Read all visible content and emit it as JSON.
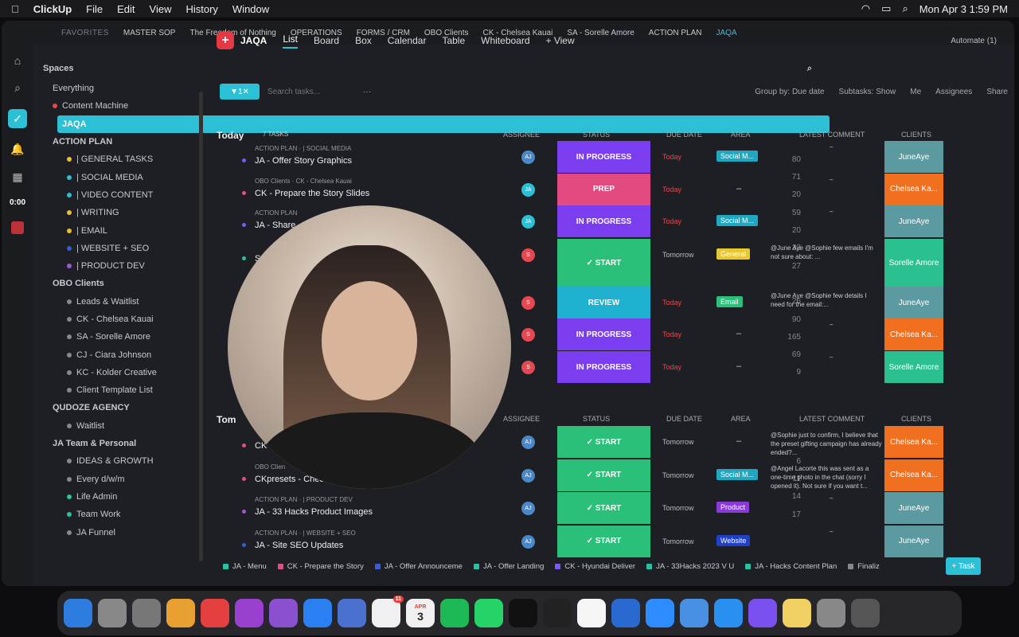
{
  "menubar": {
    "app": "ClickUp",
    "items": [
      "File",
      "Edit",
      "View",
      "History",
      "Window"
    ],
    "clock": "Mon Apr 3  1:59 PM"
  },
  "favorites": {
    "label": "FAVORITES",
    "items": [
      "MASTER SOP",
      "The Freedom of Nothing",
      "OPERATIONS",
      "FORMS / CRM",
      "OBO Clients",
      "CK - Chelsea Kauai",
      "SA - Sorelle Amore",
      "ACTION PLAN",
      "JAQA"
    ]
  },
  "rail": {
    "timer": "0:00"
  },
  "sidebar": {
    "title": "Spaces",
    "rows": [
      {
        "label": "Everything",
        "count": "",
        "dot": "",
        "kind": "top"
      },
      {
        "label": "Content Machine",
        "count": "",
        "dot": "#e54850",
        "kind": "space"
      },
      {
        "label": "JAQA",
        "count": "",
        "dot": "",
        "kind": "selected"
      },
      {
        "label": "ACTION PLAN",
        "count": "",
        "dot": "",
        "kind": "folder"
      },
      {
        "label": "| GENERAL TASKS",
        "count": "80",
        "dot": "#e8c030"
      },
      {
        "label": "| SOCIAL MEDIA",
        "count": "71",
        "dot": "#2bc0d6"
      },
      {
        "label": "| VIDEO CONTENT",
        "count": "20",
        "dot": "#2bc0d6"
      },
      {
        "label": "| WRITING",
        "count": "59",
        "dot": "#e8c030"
      },
      {
        "label": "| EMAIL",
        "count": "20",
        "dot": "#e8c030"
      },
      {
        "label": "| WEBSITE + SEO",
        "count": "33",
        "dot": "#3a5ad6"
      },
      {
        "label": "| PRODUCT DEV",
        "count": "27",
        "dot": "#9a5ad6"
      },
      {
        "label": "OBO Clients",
        "count": "",
        "dot": "",
        "kind": "folder"
      },
      {
        "label": "Leads & Waitlist",
        "count": "26",
        "dot": "#888"
      },
      {
        "label": "CK - Chelsea Kauai",
        "count": "90",
        "dot": "#888"
      },
      {
        "label": "SA - Sorelle Amore",
        "count": "165",
        "dot": "#888"
      },
      {
        "label": "CJ - Ciara Johnson",
        "count": "69",
        "dot": "#888"
      },
      {
        "label": "KC - Kolder Creative",
        "count": "9",
        "dot": "#888"
      },
      {
        "label": "Client Template List",
        "count": "",
        "dot": "#888"
      },
      {
        "label": "QUDOZE AGENCY",
        "count": "",
        "dot": "",
        "kind": "folder"
      },
      {
        "label": "Waitlist",
        "count": "",
        "dot": "#888"
      },
      {
        "label": "JA Team & Personal",
        "count": "",
        "dot": "",
        "kind": "folder"
      },
      {
        "label": "IDEAS & GROWTH",
        "count": "6",
        "dot": "#888"
      },
      {
        "label": "Every d/w/m",
        "count": "11",
        "dot": "#888"
      },
      {
        "label": "Life Admin",
        "count": "14",
        "dot": "#2bc0a0"
      },
      {
        "label": "Team Work",
        "count": "17",
        "dot": "#2bc0a0"
      },
      {
        "label": "JA Funnel",
        "count": "",
        "dot": "#888"
      }
    ]
  },
  "viewbar": {
    "space": "JAQA",
    "tabs": [
      "List",
      "Board",
      "Box",
      "Calendar",
      "Table",
      "Whiteboard"
    ],
    "add_view": "+ View",
    "automate": "Automate (1)"
  },
  "toolbar": {
    "filter_count": "1",
    "search_placeholder": "Search tasks...",
    "group_by": "Group by: Due date",
    "subtasks": "Subtasks: Show",
    "me": "Me",
    "assignees": "Assignees",
    "share": "Share"
  },
  "columns": {
    "assignee": "ASSIGNEE",
    "status": "STATUS",
    "due": "DUE DATE",
    "area": "AREA",
    "comment": "LATEST COMMENT",
    "clients": "CLIENTS"
  },
  "today": {
    "name": "Today",
    "tasks": "7 TASKS",
    "assignee_count": "1",
    "status_count": "2",
    "rows": [
      {
        "meta": "ACTION PLAN  ·  | SOCIAL MEDIA",
        "name": "JA - Offer Story Graphics",
        "bullet": "#7a5af5",
        "av": "AJ",
        "avc": "#4a88c8",
        "status": "IN PROGRESS",
        "sc": "#7a3ef0",
        "due": "Today",
        "dc": "#e54850",
        "area": "Social M...",
        "ac": "#20a8c0",
        "cmt": "–",
        "client": "JuneAye",
        "cc": "#5b9aa0"
      },
      {
        "meta": "OBO Clients  ·  CK - Chelsea Kauai",
        "name": "CK - Prepare the Story Slides",
        "bullet": "#e05080",
        "av": "JA",
        "avc": "#2bc0d6",
        "status": "PREP",
        "sc": "#e04a80",
        "due": "Today",
        "dc": "#e54850",
        "area": "",
        "ac": "",
        "cmt": "–",
        "client": "Chelsea Ka...",
        "cc": "#f07020"
      },
      {
        "meta": "ACTION PLAN",
        "name": "JA - Share",
        "bullet": "#7a5af5",
        "av": "JA",
        "avc": "#2bc0d6",
        "status": "IN PROGRESS",
        "sc": "#7a3ef0",
        "due": "Today",
        "dc": "#e54850",
        "area": "Social M...",
        "ac": "#20a8c0",
        "cmt": "–",
        "client": "JuneAye",
        "cc": "#5b9aa0"
      },
      {
        "meta": "",
        "name": "S",
        "bullet": "#2bc0a0",
        "av": "S",
        "avc": "#e54850",
        "status": "✓ START",
        "sc": "#2bc07a",
        "due": "Tomorrow",
        "dc": "#bbb",
        "area": "General",
        "ac": "#e8c830",
        "cmt": "@June Aye @Sophie few emails I'm not sure about: ...",
        "client": "Sorelle Amore",
        "cc": "#2bc090"
      },
      {
        "meta": "",
        "name": "",
        "bullet": "#2bc0a0",
        "av": "S",
        "avc": "#e54850",
        "status": "REVIEW",
        "sc": "#20b0d0",
        "due": "Today",
        "dc": "#e54850",
        "area": "Email",
        "ac": "#2bc07a",
        "cmt": "@June Aye @Sophie few details I need for the email:...",
        "client": "JuneAye",
        "cc": "#5b9aa0"
      },
      {
        "meta": "",
        "name": "",
        "bullet": "#2bc0a0",
        "av": "S",
        "avc": "#e54850",
        "status": "IN PROGRESS",
        "sc": "#7a3ef0",
        "due": "Today",
        "dc": "#e54850",
        "area": "",
        "ac": "",
        "cmt": "–",
        "client": "Chelsea Ka...",
        "cc": "#f07020"
      },
      {
        "meta": "",
        "name": "",
        "bullet": "#2bc0a0",
        "av": "S",
        "avc": "#e54850",
        "status": "IN PROGRESS",
        "sc": "#7a3ef0",
        "due": "Today",
        "dc": "#e54850",
        "area": "",
        "ac": "",
        "cmt": "–",
        "client": "Sorelle Amore",
        "cc": "#2bc090"
      }
    ]
  },
  "tomorrow": {
    "name": "Tom",
    "assignee_count": "1",
    "status_count": "2",
    "rows": [
      {
        "meta": "",
        "name": "CK I",
        "bullet": "#e05080",
        "av": "AJ",
        "avc": "#4a88c8",
        "status": "✓ START",
        "sc": "#2bc07a",
        "due": "Tomorrow",
        "dc": "#bbb",
        "area": "",
        "ac": "",
        "cmt": "@Sophie just to confirm, I believe that the preset gifting campaign has already ended?...",
        "client": "Chelsea Ka...",
        "cc": "#f07020"
      },
      {
        "meta": "OBO Clien",
        "name": "CKpresets - Check",
        "bullet": "#e05080",
        "av": "AJ",
        "avc": "#4a88c8",
        "status": "✓ START",
        "sc": "#2bc07a",
        "due": "Tomorrow",
        "dc": "#bbb",
        "area": "Social M...",
        "ac": "#20a8c0",
        "cmt": "@Angel Lacorte this was sent as a one-time photo in the chat (sorry I opened it). Not sure if you want t...",
        "client": "Chelsea Ka...",
        "cc": "#f07020"
      },
      {
        "meta": "ACTION PLAN  ·  | PRODUCT DEV",
        "name": "JA - 33 Hacks Product Images",
        "bullet": "#9a5ad6",
        "av": "AJ",
        "avc": "#4a88c8",
        "status": "✓ START",
        "sc": "#2bc07a",
        "due": "Tomorrow",
        "dc": "#bbb",
        "area": "Product",
        "ac": "#8a3ad6",
        "cmt": "–",
        "client": "JuneAye",
        "cc": "#5b9aa0"
      },
      {
        "meta": "ACTION PLAN  ·  | WEBSITE + SEO",
        "name": "JA - Site SEO Updates",
        "bullet": "#3a5ad6",
        "av": "AJ",
        "avc": "#4a88c8",
        "status": "✓ START",
        "sc": "#2bc07a",
        "due": "Tomorrow",
        "dc": "#bbb",
        "area": "Website",
        "ac": "#2040c8",
        "cmt": "–",
        "client": "JuneAye",
        "cc": "#5b9aa0"
      }
    ]
  },
  "bottomtabs": [
    {
      "label": "JA - Menu",
      "c": "#2bc0a0"
    },
    {
      "label": "CK - Prepare the Story",
      "c": "#e05080"
    },
    {
      "label": "JA - Offer Announceme",
      "c": "#3a5ad6"
    },
    {
      "label": "JA - Offer Landing",
      "c": "#2bc0a0"
    },
    {
      "label": "CK - Hyundai Deliver",
      "c": "#7a5af5"
    },
    {
      "label": "JA - 33Hacks 2023 V U",
      "c": "#2bc0a0"
    },
    {
      "label": "JA - Hacks Content Plan",
      "c": "#2bc0a0"
    },
    {
      "label": "Finaliz",
      "c": "#888"
    }
  ],
  "task_button": "+ Task",
  "dock": [
    "Finder",
    "Launchpad",
    "Settings",
    "Photos",
    "Chrome",
    "Podcasts",
    "Element",
    "Messenger",
    "Perplexity",
    "Reminders",
    "Calendar",
    "Spotify",
    "WhatsApp",
    "TikTok",
    "Figma",
    "Notion",
    "Docs",
    "Zoom",
    "Mail",
    "Safari",
    "ClickUp",
    "Notes",
    "Preview",
    "Trash"
  ],
  "calendar_day": "3",
  "calendar_month": "APR",
  "reminders_badge": "11"
}
